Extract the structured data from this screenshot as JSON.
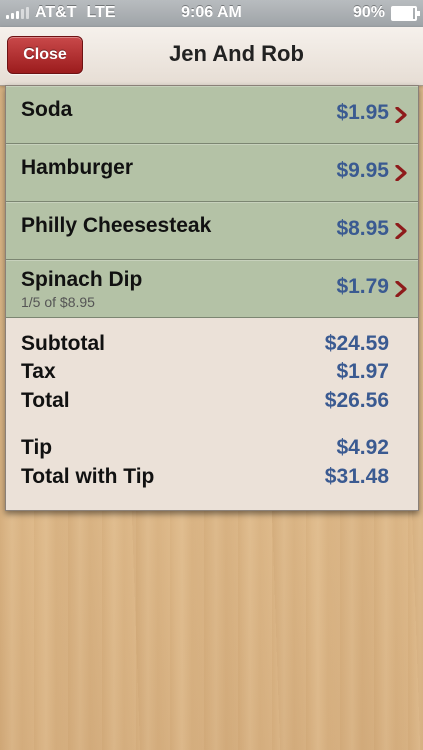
{
  "status_bar": {
    "carrier": "AT&T",
    "network": "LTE",
    "time": "9:06 AM",
    "battery": "90%",
    "battery_level": 0.9
  },
  "nav": {
    "close_label": "Close",
    "title": "Jen And Rob"
  },
  "items": [
    {
      "name": "Soda",
      "price": "$1.95",
      "detail": ""
    },
    {
      "name": "Hamburger",
      "price": "$9.95",
      "detail": ""
    },
    {
      "name": "Philly Cheesesteak",
      "price": "$8.95",
      "detail": ""
    },
    {
      "name": "Spinach Dip",
      "price": "$1.79",
      "detail": "1/5 of $8.95"
    }
  ],
  "totals": {
    "subtotal_label": "Subtotal",
    "subtotal": "$24.59",
    "tax_label": "Tax",
    "tax": "$1.97",
    "total_label": "Total",
    "total": "$26.56",
    "tip_label": "Tip",
    "tip": "$4.92",
    "total_with_tip_label": "Total with Tip",
    "total_with_tip": "$31.48"
  },
  "colors": {
    "accent_red": "#9c1c1d",
    "price_blue": "#3a5a91",
    "row_green": "#b4c2a6",
    "card_bg": "#ebe1d8"
  }
}
